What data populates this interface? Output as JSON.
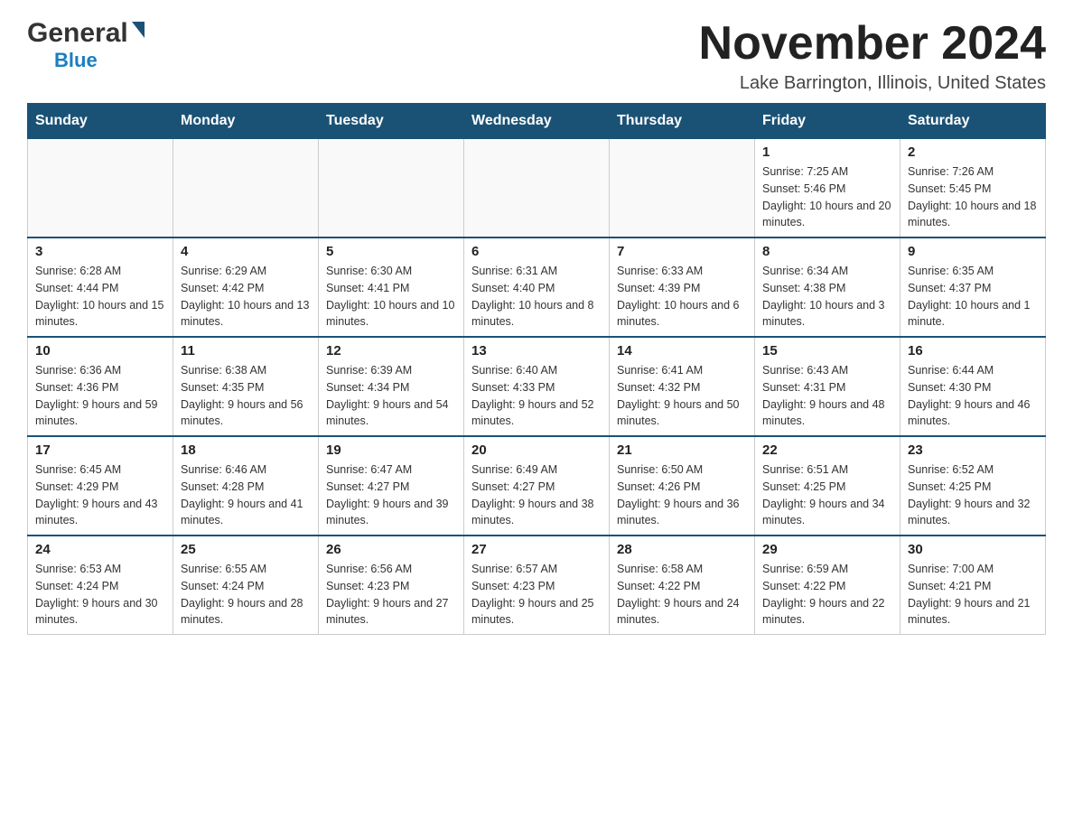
{
  "logo": {
    "general": "General",
    "blue": "Blue",
    "alt": "GeneralBlue logo"
  },
  "title": "November 2024",
  "location": "Lake Barrington, Illinois, United States",
  "days_of_week": [
    "Sunday",
    "Monday",
    "Tuesday",
    "Wednesday",
    "Thursday",
    "Friday",
    "Saturday"
  ],
  "weeks": [
    [
      {
        "day": "",
        "info": ""
      },
      {
        "day": "",
        "info": ""
      },
      {
        "day": "",
        "info": ""
      },
      {
        "day": "",
        "info": ""
      },
      {
        "day": "",
        "info": ""
      },
      {
        "day": "1",
        "info": "Sunrise: 7:25 AM\nSunset: 5:46 PM\nDaylight: 10 hours and 20 minutes."
      },
      {
        "day": "2",
        "info": "Sunrise: 7:26 AM\nSunset: 5:45 PM\nDaylight: 10 hours and 18 minutes."
      }
    ],
    [
      {
        "day": "3",
        "info": "Sunrise: 6:28 AM\nSunset: 4:44 PM\nDaylight: 10 hours and 15 minutes."
      },
      {
        "day": "4",
        "info": "Sunrise: 6:29 AM\nSunset: 4:42 PM\nDaylight: 10 hours and 13 minutes."
      },
      {
        "day": "5",
        "info": "Sunrise: 6:30 AM\nSunset: 4:41 PM\nDaylight: 10 hours and 10 minutes."
      },
      {
        "day": "6",
        "info": "Sunrise: 6:31 AM\nSunset: 4:40 PM\nDaylight: 10 hours and 8 minutes."
      },
      {
        "day": "7",
        "info": "Sunrise: 6:33 AM\nSunset: 4:39 PM\nDaylight: 10 hours and 6 minutes."
      },
      {
        "day": "8",
        "info": "Sunrise: 6:34 AM\nSunset: 4:38 PM\nDaylight: 10 hours and 3 minutes."
      },
      {
        "day": "9",
        "info": "Sunrise: 6:35 AM\nSunset: 4:37 PM\nDaylight: 10 hours and 1 minute."
      }
    ],
    [
      {
        "day": "10",
        "info": "Sunrise: 6:36 AM\nSunset: 4:36 PM\nDaylight: 9 hours and 59 minutes."
      },
      {
        "day": "11",
        "info": "Sunrise: 6:38 AM\nSunset: 4:35 PM\nDaylight: 9 hours and 56 minutes."
      },
      {
        "day": "12",
        "info": "Sunrise: 6:39 AM\nSunset: 4:34 PM\nDaylight: 9 hours and 54 minutes."
      },
      {
        "day": "13",
        "info": "Sunrise: 6:40 AM\nSunset: 4:33 PM\nDaylight: 9 hours and 52 minutes."
      },
      {
        "day": "14",
        "info": "Sunrise: 6:41 AM\nSunset: 4:32 PM\nDaylight: 9 hours and 50 minutes."
      },
      {
        "day": "15",
        "info": "Sunrise: 6:43 AM\nSunset: 4:31 PM\nDaylight: 9 hours and 48 minutes."
      },
      {
        "day": "16",
        "info": "Sunrise: 6:44 AM\nSunset: 4:30 PM\nDaylight: 9 hours and 46 minutes."
      }
    ],
    [
      {
        "day": "17",
        "info": "Sunrise: 6:45 AM\nSunset: 4:29 PM\nDaylight: 9 hours and 43 minutes."
      },
      {
        "day": "18",
        "info": "Sunrise: 6:46 AM\nSunset: 4:28 PM\nDaylight: 9 hours and 41 minutes."
      },
      {
        "day": "19",
        "info": "Sunrise: 6:47 AM\nSunset: 4:27 PM\nDaylight: 9 hours and 39 minutes."
      },
      {
        "day": "20",
        "info": "Sunrise: 6:49 AM\nSunset: 4:27 PM\nDaylight: 9 hours and 38 minutes."
      },
      {
        "day": "21",
        "info": "Sunrise: 6:50 AM\nSunset: 4:26 PM\nDaylight: 9 hours and 36 minutes."
      },
      {
        "day": "22",
        "info": "Sunrise: 6:51 AM\nSunset: 4:25 PM\nDaylight: 9 hours and 34 minutes."
      },
      {
        "day": "23",
        "info": "Sunrise: 6:52 AM\nSunset: 4:25 PM\nDaylight: 9 hours and 32 minutes."
      }
    ],
    [
      {
        "day": "24",
        "info": "Sunrise: 6:53 AM\nSunset: 4:24 PM\nDaylight: 9 hours and 30 minutes."
      },
      {
        "day": "25",
        "info": "Sunrise: 6:55 AM\nSunset: 4:24 PM\nDaylight: 9 hours and 28 minutes."
      },
      {
        "day": "26",
        "info": "Sunrise: 6:56 AM\nSunset: 4:23 PM\nDaylight: 9 hours and 27 minutes."
      },
      {
        "day": "27",
        "info": "Sunrise: 6:57 AM\nSunset: 4:23 PM\nDaylight: 9 hours and 25 minutes."
      },
      {
        "day": "28",
        "info": "Sunrise: 6:58 AM\nSunset: 4:22 PM\nDaylight: 9 hours and 24 minutes."
      },
      {
        "day": "29",
        "info": "Sunrise: 6:59 AM\nSunset: 4:22 PM\nDaylight: 9 hours and 22 minutes."
      },
      {
        "day": "30",
        "info": "Sunrise: 7:00 AM\nSunset: 4:21 PM\nDaylight: 9 hours and 21 minutes."
      }
    ]
  ]
}
